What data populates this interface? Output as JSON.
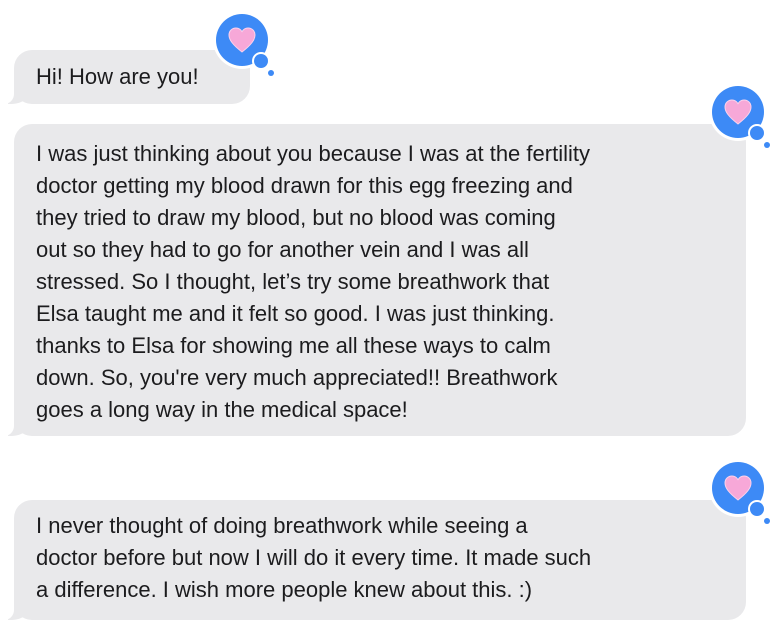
{
  "conversation": {
    "messages": [
      {
        "text": "Hi! How are you!",
        "reaction": "heart-icon"
      },
      {
        "text": "I was just thinking about you because I was at the fertility\ndoctor getting my blood drawn for this egg freezing and\nthey tried to draw my blood, but no blood was coming\nout so they had to go for another vein and I was all\nstressed. So I thought, let’s try some breathwork that\nElsa taught me and it felt so good. I was just thinking.\nthanks to Elsa for showing me all these ways to calm\ndown. So, you're very much appreciated!! Breathwork\ngoes a long way in the medical space!",
        "reaction": "heart-icon"
      },
      {
        "text": "I never thought of doing breathwork while seeing a\ndoctor before but now I will do it every time. It made such\na difference. I wish more people knew about this. :)",
        "reaction": "heart-icon"
      }
    ]
  },
  "colors": {
    "bubble_background": "#e9e9eb",
    "text": "#1c1c1e",
    "reaction_badge": "#3d8af6",
    "heart": "#f7a8d8"
  }
}
